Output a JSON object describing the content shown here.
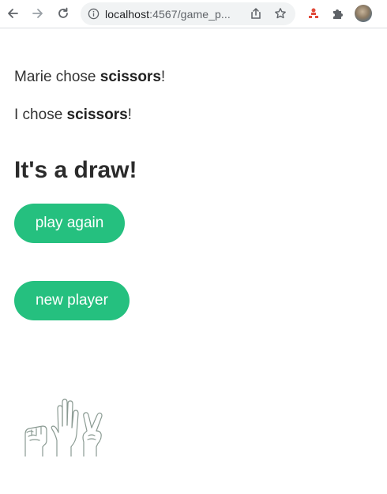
{
  "browser": {
    "url_host": "localhost",
    "url_rest": ":4567/game_p...",
    "icons": {
      "back": "back-arrow-icon",
      "forward": "forward-arrow-icon",
      "reload": "reload-icon",
      "info": "info-icon",
      "share": "share-icon",
      "bookmark": "star-icon",
      "extension_red": "extension-icon",
      "extensions": "puzzle-icon"
    }
  },
  "game": {
    "opponent_name": "Marie",
    "chose_text": " chose ",
    "opponent_choice": "scissors",
    "exclamation": "!",
    "me_text": "I chose ",
    "my_choice": "scissors",
    "result": "It's a draw!",
    "play_again_label": "play again",
    "new_player_label": "new player"
  },
  "colors": {
    "accent": "#25c07f",
    "text": "#333333"
  }
}
